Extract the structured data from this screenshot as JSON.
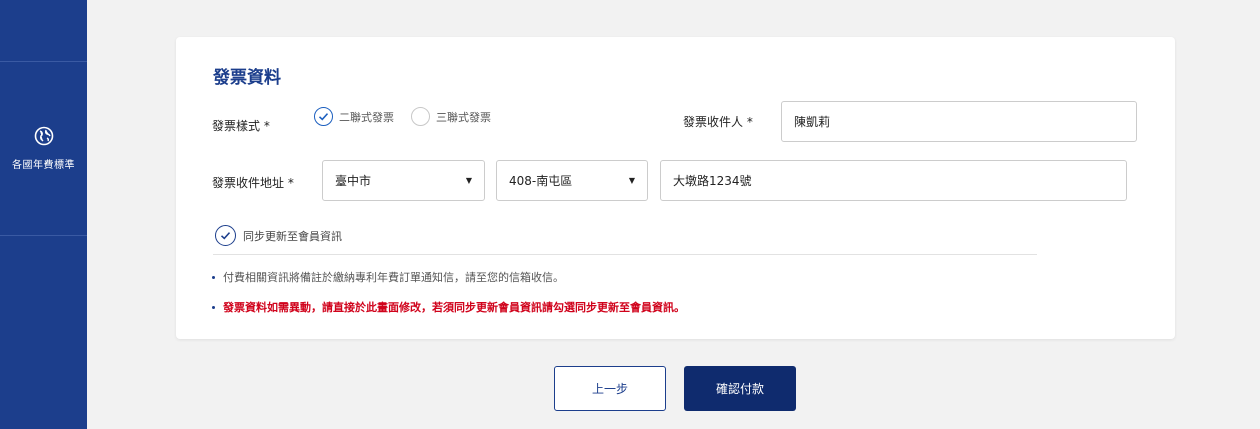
{
  "sidebar": {
    "items": [
      {
        "label": "各國年費標準",
        "icon": "globe-icon"
      }
    ],
    "color": "#1c3e8c"
  },
  "invoice": {
    "title": "發票資料",
    "type_label": "發票樣式 *",
    "type_options": [
      {
        "label": "二聯式發票",
        "checked": true
      },
      {
        "label": "三聯式發票",
        "checked": false
      }
    ],
    "recipient_label": "發票收件人 *",
    "recipient_value": "陳凱莉",
    "address_label": "發票收件地址 *",
    "city": "臺中市",
    "district": "408-南屯區",
    "street": "大墩路1234號",
    "sync_label": "同步更新至會員資訊",
    "sync_checked": true,
    "notes": [
      "付費相關資訊將備註於繳納專利年費訂單通知信，請至您的信箱收信。",
      "發票資料如需異動，請直接於此畫面修改，若須同步更新會員資訊請勾選同步更新至會員資訊。"
    ]
  },
  "actions": {
    "back_label": "上一步",
    "confirm_label": "確認付款"
  },
  "colors": {
    "primary": "#1c3e8c",
    "button_dark": "#0f2b6e",
    "warning": "#d0021b",
    "background": "#f2f2f2"
  }
}
